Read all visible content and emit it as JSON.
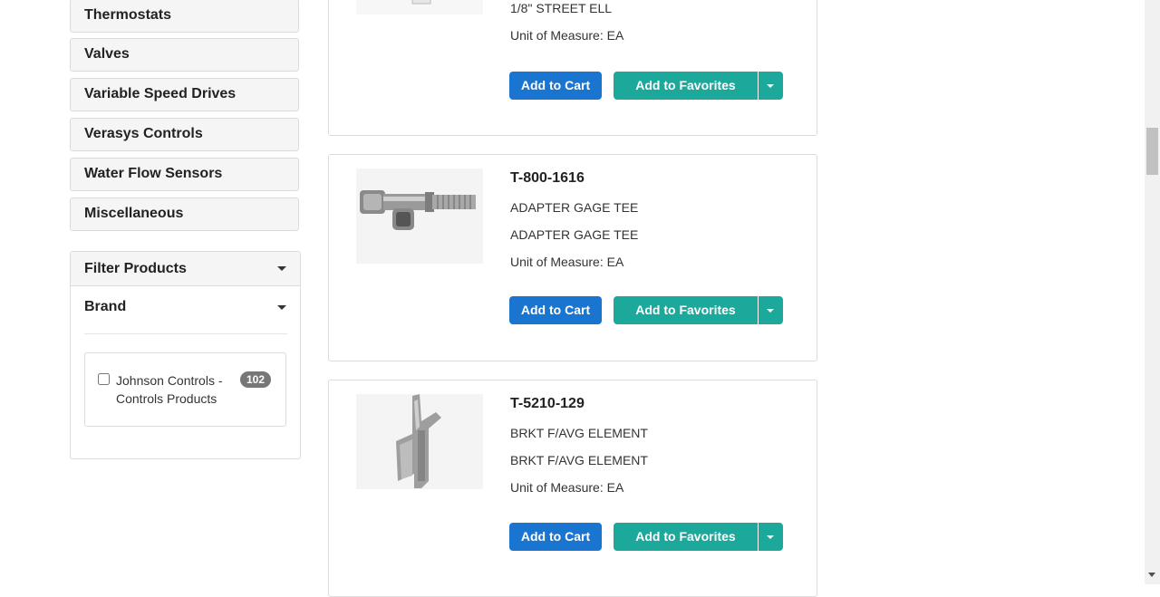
{
  "sidebar": {
    "categories": [
      {
        "label": "Thermostats"
      },
      {
        "label": "Valves"
      },
      {
        "label": "Variable Speed Drives"
      },
      {
        "label": "Verasys Controls"
      },
      {
        "label": "Water Flow Sensors"
      },
      {
        "label": "Miscellaneous"
      }
    ]
  },
  "filter": {
    "title": "Filter Products",
    "brand_title": "Brand",
    "brands": [
      {
        "label": "Johnson Controls - Controls Products",
        "count": "102",
        "checked": false
      }
    ]
  },
  "products": [
    {
      "sku": "",
      "desc1": "1/8\" STREET ELL",
      "desc2": "",
      "uom": "Unit of Measure: EA",
      "cart_label": "Add to Cart",
      "fav_label": "Add to Favorites"
    },
    {
      "sku": "T-800-1616",
      "desc1": "ADAPTER GAGE TEE",
      "desc2": "ADAPTER GAGE TEE",
      "uom": "Unit of Measure: EA",
      "cart_label": "Add to Cart",
      "fav_label": "Add to Favorites"
    },
    {
      "sku": "T-5210-129",
      "desc1": "BRKT F/AVG ELEMENT",
      "desc2": "BRKT F/AVG ELEMENT",
      "uom": "Unit of Measure: EA",
      "cart_label": "Add to Cart",
      "fav_label": "Add to Favorites"
    }
  ],
  "colors": {
    "cart_button": "#1a75d1",
    "favorites_button": "#1ca99c"
  }
}
